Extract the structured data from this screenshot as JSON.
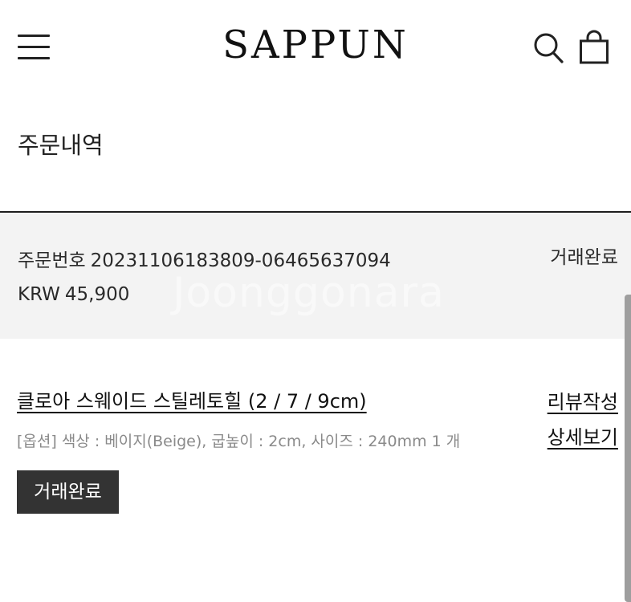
{
  "header": {
    "logo": "SAPPUN",
    "menu_icon": "hamburger-menu-icon",
    "search_icon": "search-icon",
    "cart_icon": "shopping-bag-icon"
  },
  "page": {
    "title": "주문내역"
  },
  "order": {
    "number_label": "주문번호",
    "number": "20231106183809-06465637094",
    "currency": "KRW",
    "amount": "45,900",
    "status": "거래완료",
    "watermark": "Joonggonara"
  },
  "item": {
    "name": "클로아 스웨이드 스틸레토힐 (2 / 7 / 9cm)",
    "option": "[옵션] 색상 : 베이지(Beige), 굽높이 : 2cm, 사이즈 : 240mm 1 개",
    "status_badge": "거래완료",
    "review_link": "리뷰작성",
    "detail_link": "상세보기"
  },
  "colors": {
    "background": "#ffffff",
    "order_box_bg": "#f3f3f3",
    "badge_bg": "#333333",
    "option_text": "#8a8a8a"
  }
}
